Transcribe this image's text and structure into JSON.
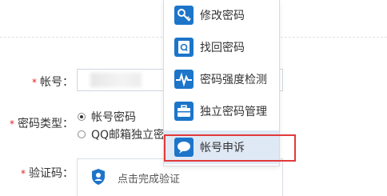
{
  "form": {
    "required_mark": "*",
    "account_label": "帐号：",
    "password_type_label": "密码类型：",
    "password_type_options": [
      "帐号密码",
      "QQ邮箱独立密"
    ],
    "captcha_label": "验证码：",
    "captcha_text": "点击完成验证"
  },
  "menu": {
    "items": [
      {
        "label": "修改密码",
        "icon": "key-icon"
      },
      {
        "label": "找回密码",
        "icon": "find-password-icon"
      },
      {
        "label": "密码强度检测",
        "icon": "pulse-icon"
      },
      {
        "label": "独立密码管理",
        "icon": "briefcase-icon"
      },
      {
        "label": "帐号申诉",
        "icon": "speech-bubble-icon"
      }
    ],
    "active_index": 4
  },
  "colors": {
    "icon_blue": "#1d75c9",
    "required_red": "#e02020",
    "highlight_red": "#e23a3a"
  }
}
